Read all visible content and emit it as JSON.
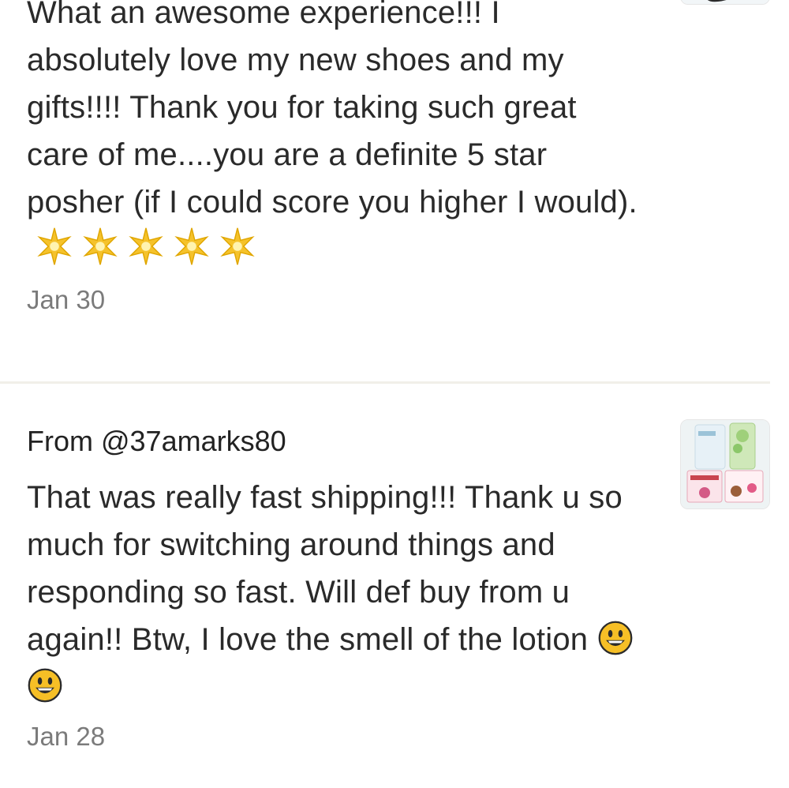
{
  "reviews": [
    {
      "from": "",
      "text": "What an awesome experience!!! I absolutely love my new shoes and my gifts!!!! Thank you for taking such great care of me....you are a definite 5 star posher (if I could score you higher I would).",
      "emoji": [
        "star-icon",
        "star-icon",
        "star-icon",
        "star-icon",
        "star-icon"
      ],
      "date": "Jan 30"
    },
    {
      "from": "From @37amarks80",
      "text": "That was really fast shipping!!! Thank u so much for switching around things and responding so fast. Will def buy from u again!! Btw, I love the smell of the lotion",
      "emoji": [
        "grinning-face-icon",
        "grinning-face-icon"
      ],
      "date": "Jan 28"
    }
  ],
  "colors": {
    "text": "#2a2a2a",
    "date": "#7b7b7b",
    "divider": "#f1efe9",
    "star": "#f5c22b",
    "smiley": "#f2b21b"
  }
}
